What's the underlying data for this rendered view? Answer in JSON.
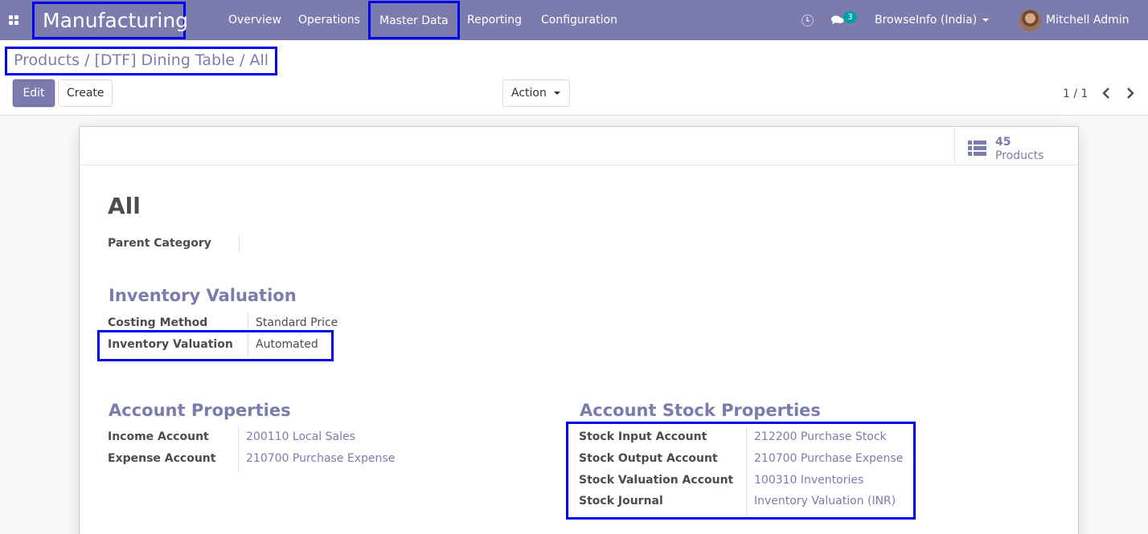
{
  "navbar": {
    "app_name": "Manufacturing",
    "menu": [
      "Overview",
      "Operations",
      "Master Data",
      "Reporting",
      "Configuration"
    ],
    "messages_count": "3",
    "company": "BrowseInfo (India)",
    "user": "Mitchell Admin",
    "icons": [
      "apps-icon",
      "clock-icon",
      "chat-icon",
      "avatar"
    ],
    "bar_color": "#7c7bad"
  },
  "control_panel": {
    "breadcrumb": "Products / [DTF] Dining Table / All",
    "edit_label": "Edit",
    "create_label": "Create",
    "action_label": "Action",
    "pager": "1 / 1"
  },
  "sheet": {
    "stat_button": {
      "value": "45",
      "label": "Products",
      "icon": "list-icon"
    },
    "title": "All",
    "parent_category_label": "Parent Category",
    "parent_category_value": "",
    "inventory_valuation": {
      "title": "Inventory Valuation",
      "fields": [
        {
          "label": "Costing Method",
          "value": "Standard Price"
        },
        {
          "label": "Inventory Valuation",
          "value": "Automated"
        }
      ]
    },
    "account_properties": {
      "title": "Account Properties",
      "fields": [
        {
          "label": "Income Account",
          "value": "200110 Local Sales"
        },
        {
          "label": "Expense Account",
          "value": "210700 Purchase Expense"
        }
      ]
    },
    "account_stock_properties": {
      "title": "Account Stock Properties",
      "fields": [
        {
          "label": "Stock Input Account",
          "value": "212200 Purchase Stock"
        },
        {
          "label": "Stock Output Account",
          "value": "210700 Purchase Expense"
        },
        {
          "label": "Stock Valuation Account",
          "value": "100310 Inventories"
        },
        {
          "label": "Stock Journal",
          "value": "Inventory Valuation (INR)"
        }
      ]
    }
  }
}
